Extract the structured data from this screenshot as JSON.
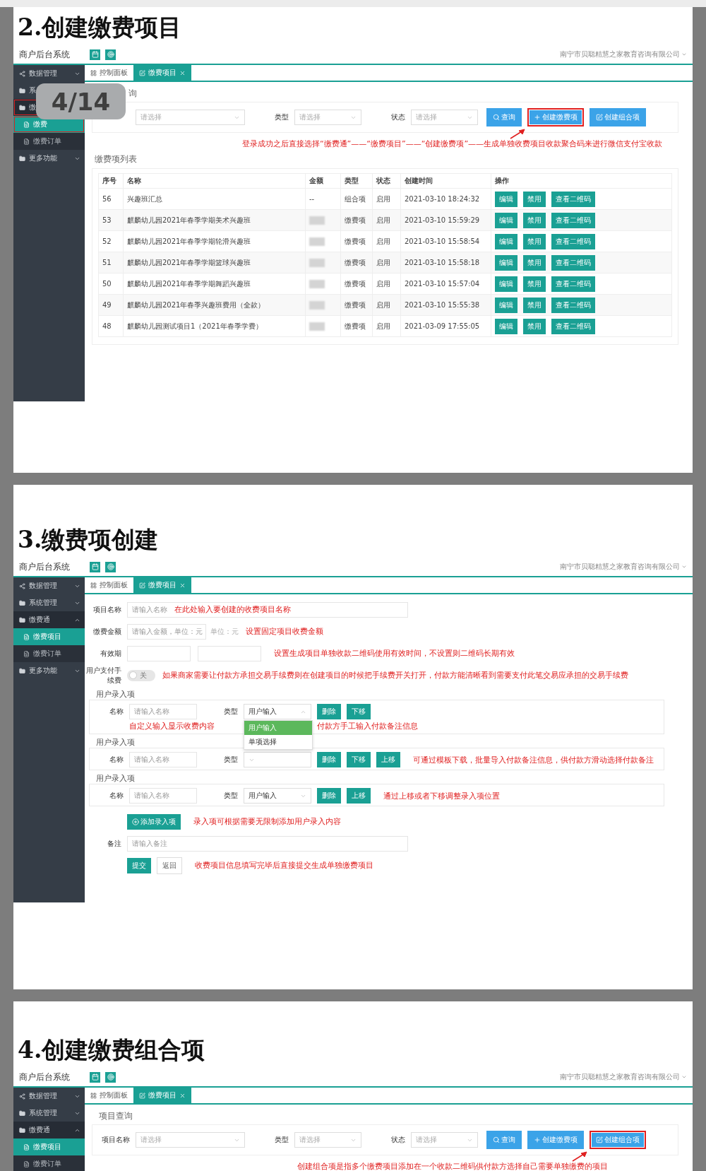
{
  "viewer": {
    "page_indicator": "4/14"
  },
  "sections": [
    {
      "title": "2.创建缴费项目",
      "screen": {
        "kind": "list",
        "brand": "商户后台系统",
        "company": "南宁市贝聪精慧之家教育咨询有限公司",
        "sidebar": [
          {
            "label": "数据管理",
            "expanded": false,
            "highlighted": false
          },
          {
            "label": "系",
            "expanded": false,
            "highlighted": false
          },
          {
            "label": "缴",
            "expanded": true,
            "highlighted": true,
            "children": [
              {
                "label": "缴费",
                "selected": true,
                "highlighted": true
              },
              {
                "label": "缴费订单",
                "selected": false,
                "highlighted": false
              }
            ]
          },
          {
            "label": "更多功能",
            "expanded": false,
            "highlighted": false
          }
        ],
        "tabs": [
          {
            "label": "控制面板",
            "selected": false,
            "closable": false
          },
          {
            "label": "缴费项目",
            "selected": true,
            "closable": true
          }
        ],
        "query": {
          "heading": "询",
          "fields": [
            {
              "placeholder": "请选择"
            },
            {
              "label": "类型",
              "placeholder": "请选择"
            },
            {
              "label": "状态",
              "placeholder": "请选择"
            }
          ],
          "buttons": [
            {
              "label": "查询",
              "kind": "search",
              "highlighted": false
            },
            {
              "label": "创建缴费项",
              "kind": "add",
              "highlighted": true
            },
            {
              "label": "创建组合项",
              "kind": "combo",
              "highlighted": false
            }
          ],
          "annotation": "登录成功之后直接选择“缴费通”——“缴费项目”——“创建缴费项”——生成单独收费项目收款聚合码来进行微信支付宝收款"
        },
        "list": {
          "heading": "缴费项列表",
          "columns": [
            "序号",
            "名称",
            "金额",
            "类型",
            "状态",
            "创建时间",
            "操作"
          ],
          "rows": [
            {
              "id": "56",
              "name": "兴趣班汇总",
              "amount": "--",
              "amount_hidden": false,
              "type": "组合项",
              "status": "启用",
              "created": "2021-03-10 18:24:32",
              "actions": [
                "编辑",
                "禁用",
                "查看二维码"
              ]
            },
            {
              "id": "53",
              "name": "麒麟幼儿园2021年春季学期美术兴趣班",
              "amount_hidden": true,
              "type": "缴费项",
              "status": "启用",
              "created": "2021-03-10 15:59:29",
              "actions": [
                "编辑",
                "禁用",
                "查看二维码"
              ]
            },
            {
              "id": "52",
              "name": "麒麟幼儿园2021年春季学期轮滑兴趣班",
              "amount_hidden": true,
              "type": "缴费项",
              "status": "启用",
              "created": "2021-03-10 15:58:54",
              "actions": [
                "编辑",
                "禁用",
                "查看二维码"
              ]
            },
            {
              "id": "51",
              "name": "麒麟幼儿园2021年春季学期篮球兴趣班",
              "amount_hidden": true,
              "type": "缴费项",
              "status": "启用",
              "created": "2021-03-10 15:58:18",
              "actions": [
                "编辑",
                "禁用",
                "查看二维码"
              ]
            },
            {
              "id": "50",
              "name": "麒麟幼儿园2021年春季学期舞蹈兴趣班",
              "amount_hidden": true,
              "type": "缴费项",
              "status": "启用",
              "created": "2021-03-10 15:57:04",
              "actions": [
                "编辑",
                "禁用",
                "查看二维码"
              ]
            },
            {
              "id": "49",
              "name": "麒麟幼儿园2021年春季兴趣班费用（全款）",
              "amount_hidden": true,
              "type": "缴费项",
              "status": "启用",
              "created": "2021-03-10 15:55:38",
              "actions": [
                "编辑",
                "禁用",
                "查看二维码"
              ]
            },
            {
              "id": "48",
              "name": "麒麟幼儿园测试项目1（2021年春季学费）",
              "amount_hidden": true,
              "type": "缴费项",
              "status": "启用",
              "created": "2021-03-09 17:55:05",
              "actions": [
                "编辑",
                "禁用",
                "查看二维码"
              ]
            }
          ]
        }
      }
    },
    {
      "title": "3.缴费项创建",
      "screen": {
        "kind": "form",
        "brand": "商户后台系统",
        "company": "南宁市贝聪精慧之家教育咨询有限公司",
        "sidebar": [
          {
            "label": "数据管理",
            "expanded": false,
            "highlighted": false
          },
          {
            "label": "系统管理",
            "expanded": false,
            "highlighted": false
          },
          {
            "label": "缴费通",
            "expanded": true,
            "highlighted": false,
            "children": [
              {
                "label": "缴费项目",
                "selected": true,
                "highlighted": false
              },
              {
                "label": "缴费订单",
                "selected": false,
                "highlighted": false
              }
            ]
          },
          {
            "label": "更多功能",
            "expanded": false,
            "highlighted": false
          }
        ],
        "tabs": [
          {
            "label": "控制面板",
            "selected": false,
            "closable": false
          },
          {
            "label": "缴费项目",
            "selected": true,
            "closable": true
          }
        ],
        "form": {
          "rows": [
            {
              "kind": "text",
              "label": "项目名称",
              "placeholder": "请输入名称",
              "note": "在此处输入要创建的收费项目名称"
            },
            {
              "kind": "amount",
              "label": "缴费金额",
              "placeholder": "请输入金额，单位：元",
              "unit": "单位：元",
              "note": "设置固定项目收费金额"
            },
            {
              "kind": "range",
              "label": "有效期",
              "note": "设置生成项目单独收款二维码使用有效时间，不设置则二维码长期有效"
            },
            {
              "kind": "switch",
              "label": "用户支付手续费",
              "on": false,
              "switch_text": "关",
              "note": "如果商家需要让付款方承担交易手续费则在创建项目的时候把手续费开关打开，付款方能清晰看到需要支付此笔交易应承担的交易手续费"
            }
          ],
          "entries": [
            {
              "legend": "用户录入项",
              "name_label": "名称",
              "name_placeholder": "请输入名称",
              "type_label": "类型",
              "type_value": "用户输入",
              "buttons": [
                "删除",
                "下移"
              ],
              "below_notes": [
                "自定义输入显示收费内容",
                "付款方手工输入付款备注信息"
              ],
              "dropdown": [
                {
                  "label": "用户输入",
                  "selected": true
                },
                {
                  "label": "单项选择",
                  "selected": false
                }
              ]
            },
            {
              "legend": "用户录入项",
              "name_label": "名称",
              "name_placeholder": "请输入名称",
              "type_label": "类型",
              "buttons": [
                "删除",
                "下移",
                "上移"
              ],
              "note": "可通过模板下载，批量导入付款备注信息，供付款方滑动选择付款备注"
            },
            {
              "legend": "用户录入项",
              "name_label": "名称",
              "name_placeholder": "请输入名称",
              "type_label": "类型",
              "type_value": "用户输入",
              "buttons": [
                "删除",
                "上移"
              ],
              "note": "通过上移或者下移调整录入项位置"
            }
          ],
          "add_button": "添加录入项",
          "add_note": "录入项可根据需要无限制添加用户录入内容",
          "remark": {
            "label": "备注",
            "placeholder": "请输入备注"
          },
          "submit": "提交",
          "back": "返回",
          "submit_note": "收费项目信息填写完毕后直接提交生成单独缴费项目"
        }
      }
    },
    {
      "title": "4.创建缴费组合项",
      "screen": {
        "kind": "list",
        "brand": "商户后台系统",
        "company": "南宁市贝聪精慧之家教育咨询有限公司",
        "sidebar": [
          {
            "label": "数据管理",
            "expanded": false,
            "highlighted": false
          },
          {
            "label": "系统管理",
            "expanded": false,
            "highlighted": false
          },
          {
            "label": "缴费通",
            "expanded": true,
            "highlighted": false,
            "children": [
              {
                "label": "缴费项目",
                "selected": true,
                "highlighted": false
              },
              {
                "label": "缴费订单",
                "selected": false,
                "highlighted": false
              }
            ]
          }
        ],
        "tabs": [
          {
            "label": "控制面板",
            "selected": false,
            "closable": false
          },
          {
            "label": "缴费项目",
            "selected": true,
            "closable": true
          }
        ],
        "query": {
          "heading": "项目查询",
          "fields": [
            {
              "label": "项目名称",
              "placeholder": "请选择"
            },
            {
              "label": "类型",
              "placeholder": "请选择"
            },
            {
              "label": "状态",
              "placeholder": "请选择"
            }
          ],
          "buttons": [
            {
              "label": "查询",
              "kind": "search",
              "highlighted": false
            },
            {
              "label": "创建缴费项",
              "kind": "add",
              "highlighted": false
            },
            {
              "label": "创建组合项",
              "kind": "combo",
              "highlighted": true
            }
          ],
          "annotation": "创建组合项是指多个缴费项目添加在一个收款二维码供付款方选择自己需要单独缴费的项目"
        }
      }
    }
  ]
}
